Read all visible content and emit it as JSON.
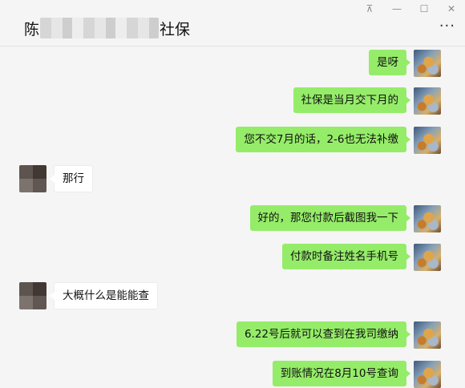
{
  "header": {
    "title_prefix": "陈",
    "title_suffix": "社保",
    "more_label": "···"
  },
  "window_controls": {
    "pin": "⊼",
    "minimize": "—",
    "maximize": "☐",
    "close": "✕"
  },
  "messages": [
    {
      "side": "right",
      "text": "是呀"
    },
    {
      "side": "right",
      "text": "社保是当月交下月的"
    },
    {
      "side": "right",
      "text": "您不交7月的话，2-6也无法补缴"
    },
    {
      "side": "left",
      "text": "那行"
    },
    {
      "side": "right",
      "text": "好的，那您付款后截图我一下"
    },
    {
      "side": "right",
      "text": "付款时备注姓名手机号"
    },
    {
      "side": "left",
      "text": "大概什么是能能查"
    },
    {
      "side": "right",
      "text": "6.22号后就可以查到在我司缴纳"
    },
    {
      "side": "right",
      "text": "到账情况在8月10号查询"
    }
  ]
}
